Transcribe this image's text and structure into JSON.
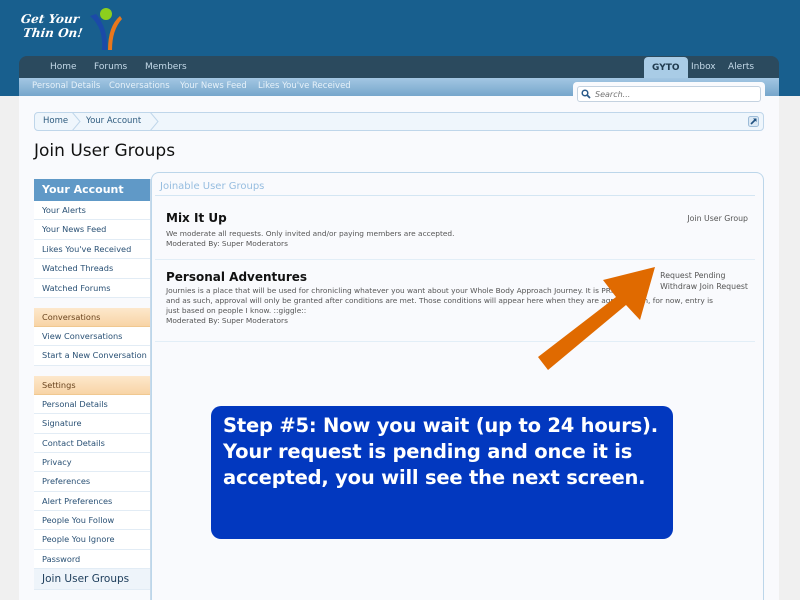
{
  "header": {
    "logo_text_line1": "Get Your",
    "logo_text_line2": "Thin On!"
  },
  "nav": {
    "tabs": [
      {
        "label": "Home"
      },
      {
        "label": "Forums"
      },
      {
        "label": "Members"
      }
    ],
    "right_tabs": [
      {
        "label": "GYTO",
        "active": true
      },
      {
        "label": "Inbox"
      },
      {
        "label": "Alerts"
      }
    ],
    "sub_tabs": [
      {
        "label": "Personal Details"
      },
      {
        "label": "Conversations"
      },
      {
        "label": "Your News Feed"
      },
      {
        "label": "Likes You've Received"
      }
    ]
  },
  "search": {
    "placeholder": "Search...",
    "icon": "search-icon"
  },
  "breadcrumb": {
    "items": [
      {
        "label": "Home"
      },
      {
        "label": "Your Account"
      }
    ],
    "jump_icon": "jump-to-icon"
  },
  "page": {
    "title": "Join User Groups"
  },
  "sidebar": {
    "heading": "Your Account",
    "account_items": [
      {
        "label": "Your Alerts"
      },
      {
        "label": "Your News Feed"
      },
      {
        "label": "Likes You've Received"
      },
      {
        "label": "Watched Threads"
      },
      {
        "label": "Watched Forums"
      }
    ],
    "conversations_heading": "Conversations",
    "conversation_items": [
      {
        "label": "View Conversations"
      },
      {
        "label": "Start a New Conversation"
      }
    ],
    "settings_heading": "Settings",
    "settings_items": [
      {
        "label": "Personal Details"
      },
      {
        "label": "Signature"
      },
      {
        "label": "Contact Details"
      },
      {
        "label": "Privacy"
      },
      {
        "label": "Preferences"
      },
      {
        "label": "Alert Preferences"
      },
      {
        "label": "People You Follow"
      },
      {
        "label": "People You Ignore"
      },
      {
        "label": "Password"
      }
    ],
    "selected_item": "Join User Groups"
  },
  "main": {
    "panel_title": "Joinable User Groups",
    "groups": [
      {
        "name": "Mix It Up",
        "description_lines": [
          "We moderate all requests. Only invited and/or paying members are accepted."
        ],
        "moderated_by": "Moderated By: Super Moderators",
        "actions": [
          "Join User Group"
        ]
      },
      {
        "name": "Personal Adventures",
        "description_lines": [
          "Journies is a place that will be used for chronicling whatever you want about your Whole Body Approach Journey. It is PRIVATE",
          "and as such, approval will only be granted after conditions are met. Those conditions will appear here when they are agreed upon, for now, entry is",
          "just based on people I know. ::giggle::"
        ],
        "moderated_by": "Moderated By: Super Moderators",
        "actions": [
          "Request Pending",
          "Withdraw Join Request"
        ]
      }
    ]
  },
  "annotation": {
    "callout_text": "Step #5:  Now you wait (up to 24 hours).  Your request is pending and once it is accepted, you will see the next screen.",
    "arrow_color": "#e06a00",
    "callout_color": "#0238bf"
  }
}
